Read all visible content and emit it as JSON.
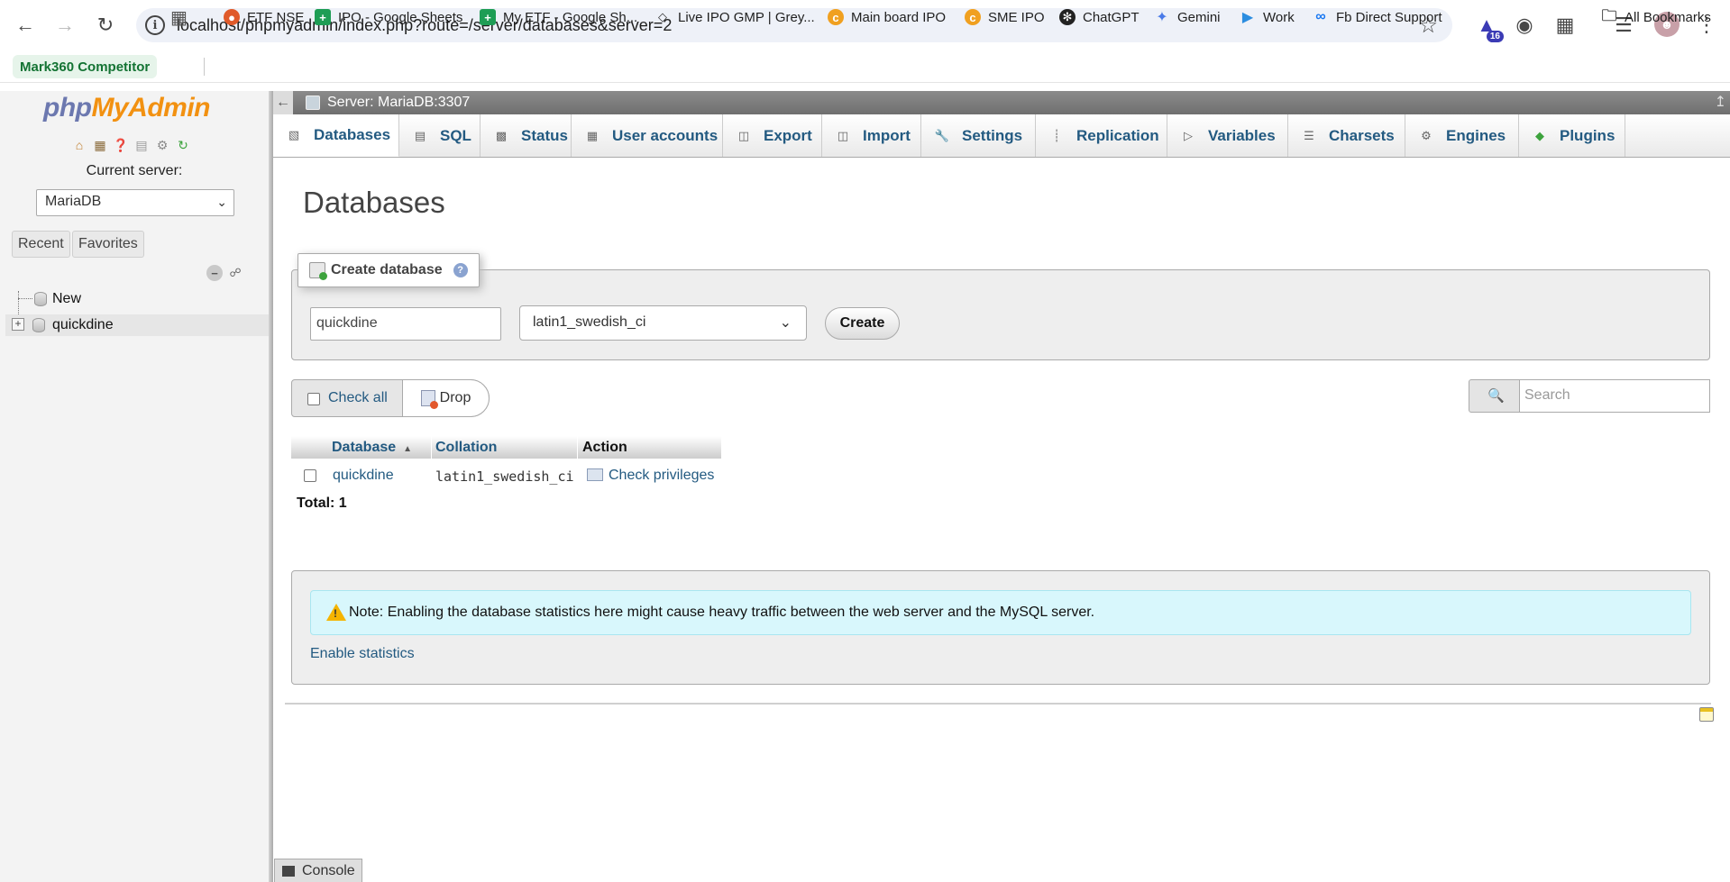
{
  "browser": {
    "url": "localhost/phpmyadmin/index.php?route=/server/databases&server=2",
    "extension_badge": "16",
    "bookmarks": [
      {
        "label": "Mark360 Competitor"
      },
      {
        "label": "ETF NSE"
      },
      {
        "label": "IPO - Google Sheets"
      },
      {
        "label": "My ETF - Google Sh..."
      },
      {
        "label": "Live IPO GMP | Grey..."
      },
      {
        "label": "Main board IPO"
      },
      {
        "label": "SME IPO"
      },
      {
        "label": "ChatGPT"
      },
      {
        "label": "Gemini"
      },
      {
        "label": "Work"
      },
      {
        "label": "Fb Direct Support"
      },
      {
        "label": "All Bookmarks"
      }
    ]
  },
  "sidebar": {
    "logo_php": "php",
    "logo_my": "My",
    "logo_admin": "Admin",
    "current_server_label": "Current server:",
    "server_value": "MariaDB",
    "recent": "Recent",
    "favorites": "Favorites",
    "tree": {
      "new": "New",
      "db": "quickdine"
    }
  },
  "header": {
    "server_title": "Server: MariaDB:3307"
  },
  "tabs": [
    {
      "label": "Databases",
      "icon": "database-icon"
    },
    {
      "label": "SQL",
      "icon": "sql-icon"
    },
    {
      "label": "Status",
      "icon": "status-icon"
    },
    {
      "label": "User accounts",
      "icon": "users-icon"
    },
    {
      "label": "Export",
      "icon": "export-icon"
    },
    {
      "label": "Import",
      "icon": "import-icon"
    },
    {
      "label": "Settings",
      "icon": "wrench-icon"
    },
    {
      "label": "Replication",
      "icon": "replication-icon"
    },
    {
      "label": "Variables",
      "icon": "variables-icon"
    },
    {
      "label": "Charsets",
      "icon": "charsets-icon"
    },
    {
      "label": "Engines",
      "icon": "engines-icon"
    },
    {
      "label": "Plugins",
      "icon": "puzzle-icon"
    }
  ],
  "main": {
    "title": "Databases",
    "create": {
      "legend": "Create database",
      "name_value": "quickdine",
      "collation_value": "latin1_swedish_ci",
      "create_button": "Create"
    },
    "check_all": "Check all",
    "drop": "Drop",
    "search_placeholder": "Search",
    "table": {
      "headers": [
        "Database",
        "Collation",
        "Action"
      ],
      "rows": [
        {
          "database": "quickdine",
          "collation": "latin1_swedish_ci",
          "action": "Check privileges"
        }
      ],
      "total": "Total: 1"
    },
    "note": "Note: Enabling the database statistics here might cause heavy traffic between the web server and the MySQL server.",
    "enable_statistics": "Enable statistics",
    "console": "Console"
  }
}
